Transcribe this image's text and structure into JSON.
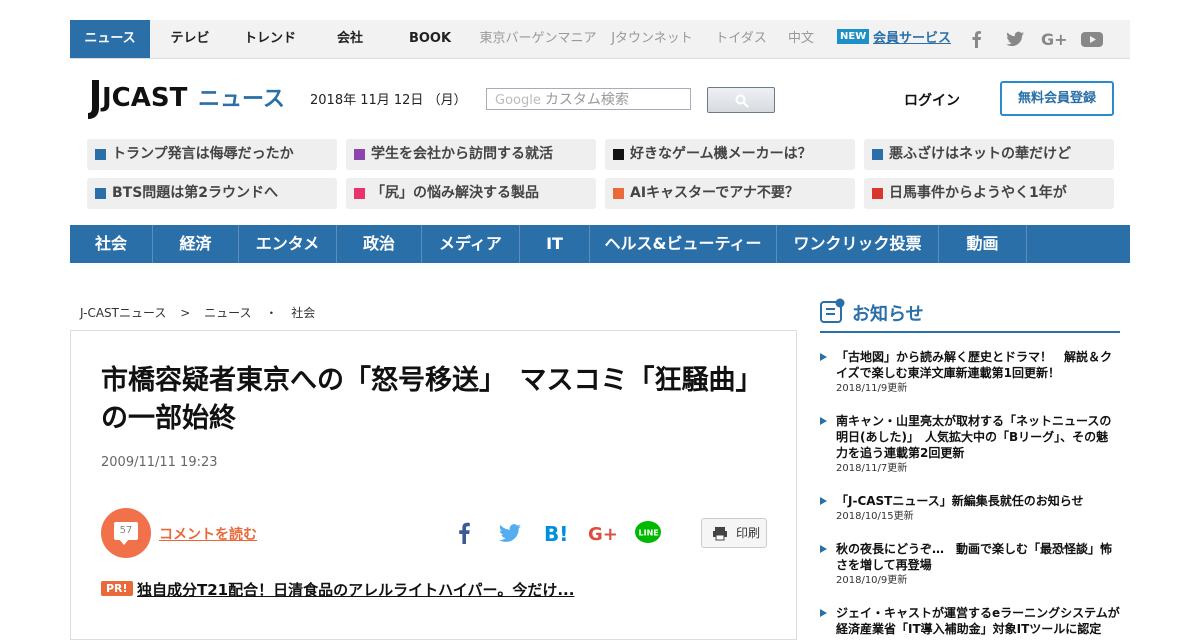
{
  "top_nav": {
    "items": [
      "ニュース",
      "テレビ",
      "トレンド",
      "会社",
      "BOOK",
      "東京バーゲンマニア",
      "Jタウンネット",
      "トイダス",
      "中文"
    ],
    "new_badge": "NEW",
    "member_link": "会員サービス",
    "social_icons": [
      "facebook-icon",
      "twitter-icon",
      "google-plus-icon",
      "youtube-icon"
    ]
  },
  "header": {
    "logo_text": "JCAST",
    "logo_sub": "ニュース",
    "date": "2018年 11月 12日 （月）",
    "search_brand": "Google",
    "search_placeholder": "カスタム検索",
    "login": "ログイン",
    "register": "無料会員登録"
  },
  "trending": [
    {
      "label": "トランプ発言は侮辱だったか",
      "color": "#2a6fa8"
    },
    {
      "label": "学生を会社から訪問する就活",
      "color": "#8e44ad"
    },
    {
      "label": "好きなゲーム機メーカーは？",
      "color": "#111111"
    },
    {
      "label": "悪ふざけはネットの華だけど",
      "color": "#2a6fa8"
    },
    {
      "label": "BTS問題は第2ラウンドへ",
      "color": "#2a6fa8"
    },
    {
      "label": "「尻」の悩み解決する製品",
      "color": "#e8336d"
    },
    {
      "label": "AIキャスターでアナ不要？",
      "color": "#e9693b"
    },
    {
      "label": "日馬事件からようやく1年が",
      "color": "#d9372b"
    }
  ],
  "categories": [
    "社会",
    "経済",
    "エンタメ",
    "政治",
    "メディア",
    "IT",
    "ヘルス&ビューティー",
    "ワンクリック投票",
    "動画"
  ],
  "breadcrumb": {
    "home": "J-CASTニュース",
    "sep": ">",
    "section": "ニュース",
    "dot": "・",
    "sub": "社会"
  },
  "article": {
    "title": "市橋容疑者東京への「怒号移送」　マスコミ「狂騒曲」の一部始終",
    "date": "2009/11/11 19:23",
    "comment_count": "57",
    "comment_link": "コメントを読む",
    "print_label": "印刷",
    "pr_badge": "PR!",
    "pr_text": "独自成分T21配合！日清食品のアレルライトハイパー。今だけ..."
  },
  "notice": {
    "title": "お知らせ",
    "items": [
      {
        "text": "「古地図」から読み解く歴史とドラマ！　解説＆クイズで楽しむ東洋文庫新連載第1回更新！",
        "date": "2018/11/9更新"
      },
      {
        "text": "南キャン・山里亮太が取材する「ネットニュースの明日(あした)」　人気拡大中の「Bリーグ」、その魅力を追う連載第2回更新",
        "date": "2018/11/7更新"
      },
      {
        "text": "「J-CASTニュース」新編集長就任のお知らせ",
        "date": "2018/10/15更新"
      },
      {
        "text": "秋の夜長にどうぞ…　動画で楽しむ「最恐怪談」怖さを増して再登場",
        "date": "2018/10/9更新"
      },
      {
        "text": "ジェイ・キャストが運営するeラーニングシステムが経済産業省「IT導入補助金」対象ITツールに認定",
        "date": ""
      }
    ]
  }
}
